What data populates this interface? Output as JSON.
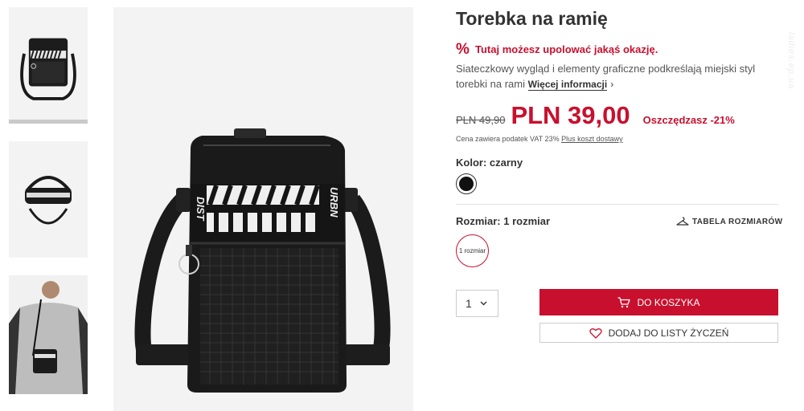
{
  "product": {
    "title": "Torebka na ramię",
    "promo_text": "Tutaj możesz upolować jakąś okazję.",
    "description": "Siateczkowy wygląd i elementy graficzne podkreślają miejski styl torebki na rami",
    "more_info_label": "Więcej informacji",
    "old_price": "PLN 49,90",
    "new_price": "PLN 39,00",
    "savings": "Oszczędzasz -21%",
    "tax_note": "Cena zawiera podatek VAT 23%",
    "shipping_link": "Plus koszt dostawy",
    "color_label": "Kolor: czarny",
    "size_label": "Rozmiar: 1 rozmiar",
    "size_chart_label": "TABELA ROZMIARÓW",
    "size_option": "1 rozmiar",
    "quantity": "1",
    "add_to_cart_label": "DO KOSZYKA",
    "wishlist_label": "DODAJ DO LISTY ŻYCZEŃ",
    "bag_print_left": "DIST",
    "bag_print_right": "URBN"
  },
  "watermark": "ladies.ep.ua",
  "icons": {
    "promo": "percent-icon",
    "cart": "cart-icon",
    "wishlist": "heart-icon",
    "size_chart": "hanger-icon",
    "chevron": "chevron-down-icon"
  },
  "colors": {
    "accent": "#c8102e",
    "swatch": "#111111",
    "text": "#333333"
  }
}
